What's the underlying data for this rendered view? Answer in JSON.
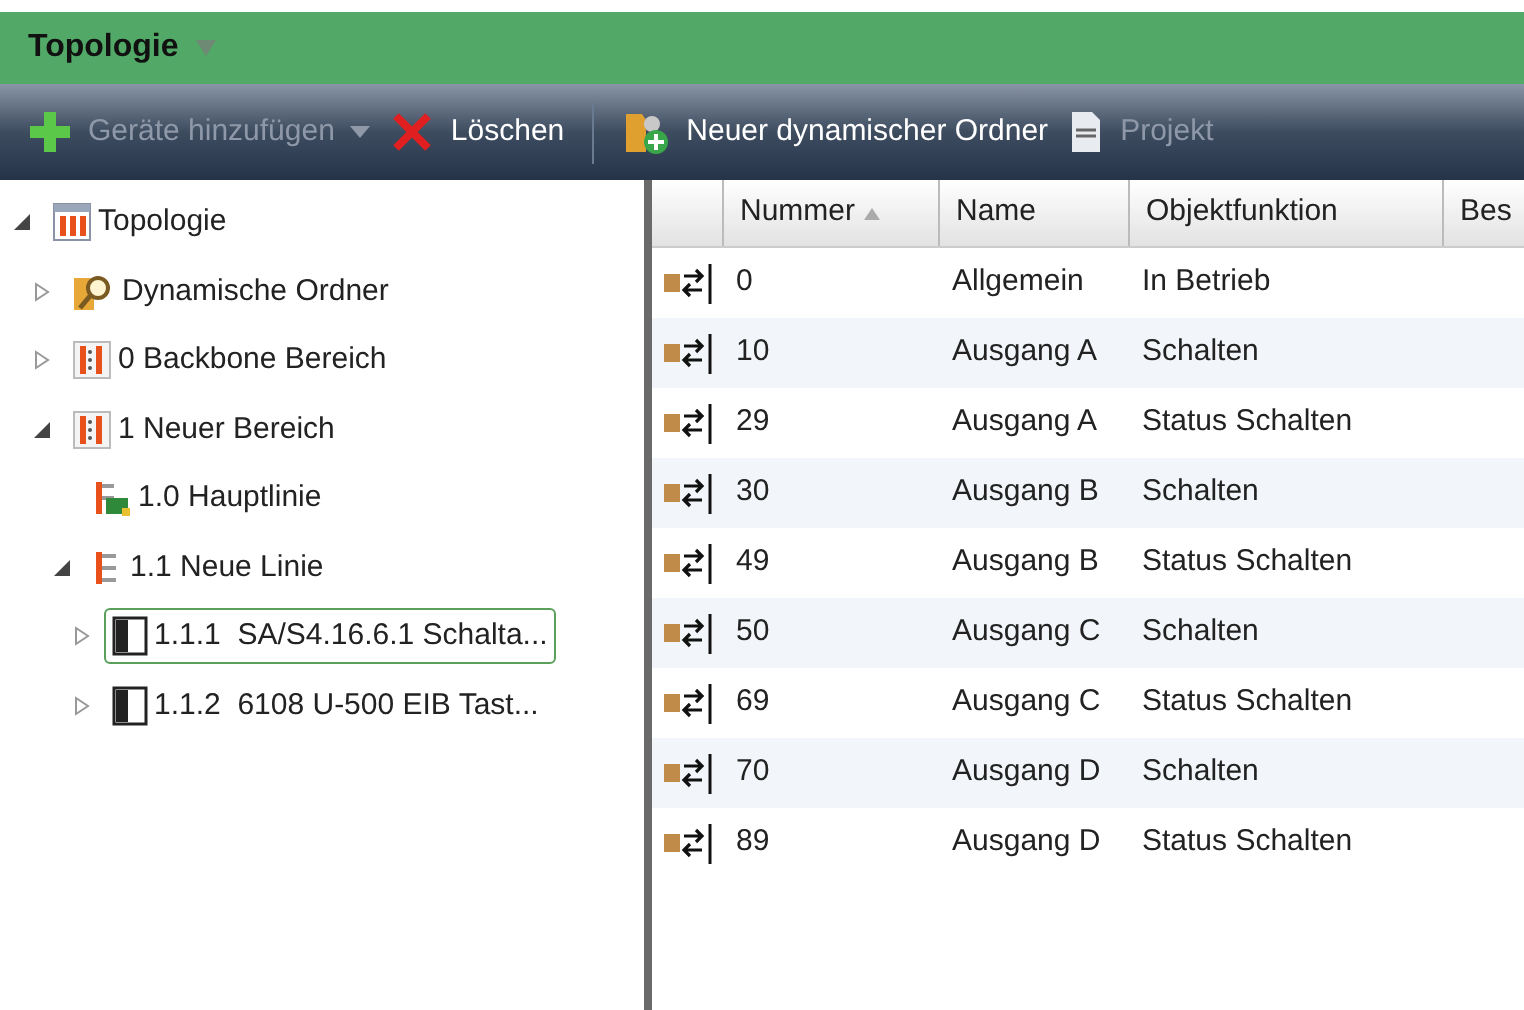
{
  "header": {
    "title": "Topologie"
  },
  "toolbar": [
    {
      "kind": "add",
      "label": "Geräte hinzufügen",
      "disabled": true,
      "dropdown": true
    },
    {
      "kind": "delete",
      "label": "Löschen",
      "disabled": false,
      "dropdown": false
    },
    {
      "kind": "folder",
      "label": "Neuer dynamischer Ordner",
      "disabled": false,
      "dropdown": false
    },
    {
      "kind": "doc",
      "label": "Projekt",
      "disabled": true,
      "dropdown": false
    }
  ],
  "tree": [
    {
      "kind": "topology",
      "label": "Topologie",
      "expanded": true,
      "selected": false,
      "children": [
        {
          "kind": "folder",
          "label": "Dynamische Ordner",
          "expanded": false,
          "selected": false
        },
        {
          "kind": "area",
          "label": "0 Backbone Bereich",
          "expanded": false,
          "selected": false
        },
        {
          "kind": "area",
          "label": "1 Neuer Bereich",
          "expanded": true,
          "selected": false,
          "children": [
            {
              "kind": "mainline",
              "label": "1.0 Hauptlinie",
              "selected": false
            },
            {
              "kind": "line",
              "label": "1.1 Neue Linie",
              "expanded": true,
              "selected": false,
              "children": [
                {
                  "kind": "device",
                  "label": "1.1.1  SA/S4.16.6.1 Schalta...",
                  "expanded": false,
                  "selected": true
                },
                {
                  "kind": "device",
                  "label": "1.1.2  6108 U-500 EIB Tast...",
                  "expanded": false,
                  "selected": false
                }
              ]
            }
          ]
        }
      ]
    }
  ],
  "table": {
    "columns": [
      {
        "label": "Nummer",
        "sorted": true
      },
      {
        "label": "Name",
        "sorted": false
      },
      {
        "label": "Objektfunktion",
        "sorted": false
      },
      {
        "label": "Bes",
        "sorted": false
      }
    ],
    "rows": [
      [
        "0",
        "Allgemein",
        "In Betrieb"
      ],
      [
        "10",
        "Ausgang A",
        "Schalten"
      ],
      [
        "29",
        "Ausgang A",
        "Status Schalten"
      ],
      [
        "30",
        "Ausgang B",
        "Schalten"
      ],
      [
        "49",
        "Ausgang B",
        "Status Schalten"
      ],
      [
        "50",
        "Ausgang C",
        "Schalten"
      ],
      [
        "69",
        "Ausgang C",
        "Status Schalten"
      ],
      [
        "70",
        "Ausgang D",
        "Schalten"
      ],
      [
        "89",
        "Ausgang D",
        "Status Schalten"
      ]
    ]
  }
}
